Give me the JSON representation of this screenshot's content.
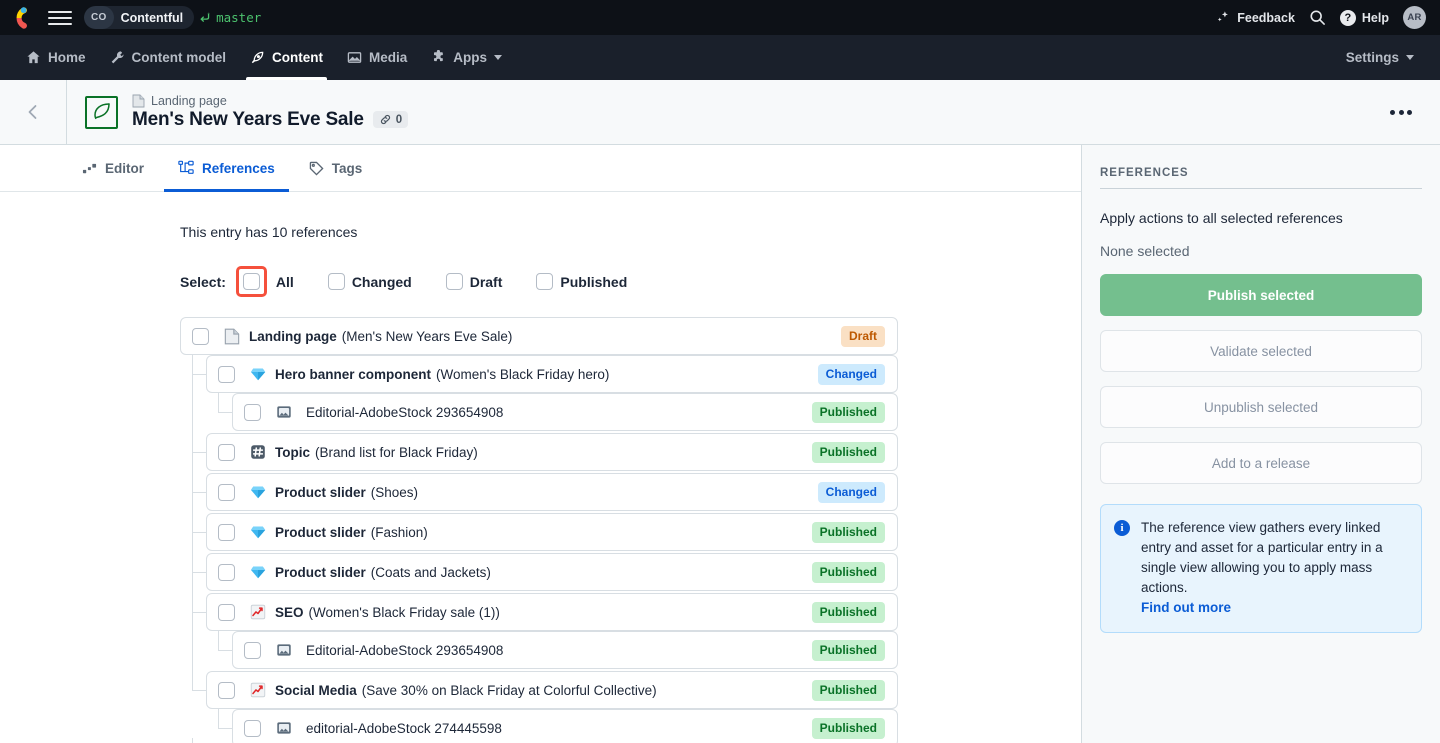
{
  "topbar": {
    "logo": "contentful-logo",
    "menu_icon": "hamburger-icon",
    "space_initials": "CO",
    "space_name": "Contentful",
    "branch_icon": "branch-icon",
    "branch_name": "master",
    "feedback_label": "Feedback",
    "feedback_icon": "sparkle-icon",
    "search_icon": "search-icon",
    "help_label": "Help",
    "help_icon": "question-mark-icon",
    "avatar_initials": "AR"
  },
  "nav": {
    "items": [
      {
        "label": "Home",
        "icon": "home-icon",
        "active": false
      },
      {
        "label": "Content model",
        "icon": "wrench-icon",
        "active": false
      },
      {
        "label": "Content",
        "icon": "pen-nib-icon",
        "active": true
      },
      {
        "label": "Media",
        "icon": "image-icon",
        "active": false
      },
      {
        "label": "Apps",
        "icon": "puzzle-icon",
        "active": false
      }
    ],
    "settings_label": "Settings"
  },
  "entry_header": {
    "back_icon": "chevron-left-icon",
    "entry_icon": "leaf-in-square-icon",
    "content_type_icon": "page-icon",
    "content_type": "Landing page",
    "title": "Men's New Years Eve Sale",
    "links_icon": "link-icon",
    "links_count": "0",
    "more_actions_icon": "ellipsis-icon"
  },
  "tabs": [
    {
      "label": "Editor",
      "icon": "editor-icon",
      "active": false
    },
    {
      "label": "References",
      "icon": "references-icon",
      "active": true
    },
    {
      "label": "Tags",
      "icon": "tag-icon",
      "active": false
    }
  ],
  "main": {
    "reference_count_text": "This entry has 10 references",
    "select_label": "Select:",
    "filters": [
      {
        "label": "All",
        "checked": false,
        "highlighted": true
      },
      {
        "label": "Changed",
        "checked": false,
        "highlighted": false
      },
      {
        "label": "Draft",
        "checked": false,
        "highlighted": false
      },
      {
        "label": "Published",
        "checked": false,
        "highlighted": false
      }
    ],
    "references": [
      {
        "level": 0,
        "icon": "page-icon",
        "glyph": "📄",
        "name": "Landing page",
        "sub": "(Men's New Years Eve Sale)",
        "status": "Draft",
        "status_class": "draft"
      },
      {
        "level": 1,
        "icon": "diamond-icon",
        "glyph": "💎",
        "name": "Hero banner component",
        "sub": "(Women's Black Friday hero)",
        "status": "Changed",
        "status_class": "changed"
      },
      {
        "level": 2,
        "icon": "asset-image-icon",
        "glyph": "🖼",
        "name": "",
        "sub": "Editorial-AdobeStock 293654908",
        "status": "Published",
        "status_class": "published"
      },
      {
        "level": 1,
        "icon": "hash-icon",
        "glyph": "#️⃣",
        "name": "Topic",
        "sub": "(Brand list for Black Friday)",
        "status": "Published",
        "status_class": "published"
      },
      {
        "level": 1,
        "icon": "diamond-icon",
        "glyph": "💎",
        "name": "Product slider",
        "sub": "(Shoes)",
        "status": "Changed",
        "status_class": "changed"
      },
      {
        "level": 1,
        "icon": "diamond-icon",
        "glyph": "💎",
        "name": "Product slider",
        "sub": "(Fashion)",
        "status": "Published",
        "status_class": "published"
      },
      {
        "level": 1,
        "icon": "diamond-icon",
        "glyph": "💎",
        "name": "Product slider",
        "sub": "(Coats and Jackets)",
        "status": "Published",
        "status_class": "published"
      },
      {
        "level": 1,
        "icon": "chart-increasing-icon",
        "glyph": "📈",
        "name": "SEO",
        "sub": "(Women's Black Friday sale (1))",
        "status": "Published",
        "status_class": "published"
      },
      {
        "level": 2,
        "icon": "asset-image-icon",
        "glyph": "🖼",
        "name": "",
        "sub": "Editorial-AdobeStock 293654908",
        "status": "Published",
        "status_class": "published"
      },
      {
        "level": 1,
        "icon": "chart-increasing-icon",
        "glyph": "📈",
        "name": "Social Media",
        "sub": "(Save 30% on Black Friday at Colorful Collective)",
        "status": "Published",
        "status_class": "published"
      },
      {
        "level": 2,
        "icon": "asset-image-icon",
        "glyph": "🖼",
        "name": "",
        "sub": "editorial-AdobeStock 274445598",
        "status": "Published",
        "status_class": "published"
      }
    ]
  },
  "sidebar": {
    "title": "REFERENCES",
    "description": "Apply actions to all selected references",
    "selection_status": "None selected",
    "buttons": [
      {
        "label": "Publish selected",
        "style": "primary"
      },
      {
        "label": "Validate selected",
        "style": "secondary"
      },
      {
        "label": "Unpublish selected",
        "style": "secondary"
      },
      {
        "label": "Add to a release",
        "style": "secondary"
      }
    ],
    "info": {
      "icon": "info-icon",
      "text": "The reference view gathers every linked entry and asset for a particular entry in a single view allowing you to apply mass actions.",
      "link_label": "Find out more"
    }
  },
  "colors": {
    "accent_blue": "#0b5cd5",
    "brand_green": "#0a7227",
    "highlight_ring": "#f5503c",
    "publish_button": "#74bf8e",
    "topbar_bg": "#0d1117",
    "navbar_bg": "#1a202b"
  }
}
